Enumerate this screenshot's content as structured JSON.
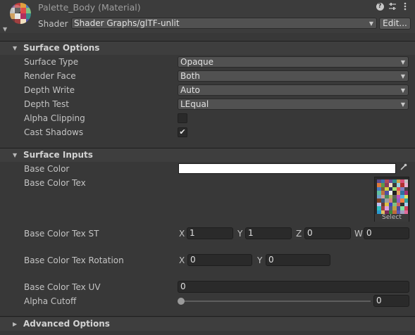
{
  "header": {
    "title": "Palette_Body (Material)",
    "shader_label": "Shader",
    "shader_value": "Shader Graphs/glTF-unlit",
    "edit_label": "Edit...",
    "icons": [
      "help-icon",
      "settings-sliders-icon",
      "more-icon"
    ]
  },
  "surface_options": {
    "title": "Surface Options",
    "rows": [
      {
        "label": "Surface Type",
        "value": "Opaque"
      },
      {
        "label": "Render Face",
        "value": "Both"
      },
      {
        "label": "Depth Write",
        "value": "Auto"
      },
      {
        "label": "Depth Test",
        "value": "LEqual"
      }
    ],
    "alpha_clipping": {
      "label": "Alpha Clipping",
      "checked": false
    },
    "cast_shadows": {
      "label": "Cast Shadows",
      "checked": true
    }
  },
  "surface_inputs": {
    "title": "Surface Inputs",
    "base_color": {
      "label": "Base Color",
      "color": "#ffffff"
    },
    "base_color_tex": {
      "label": "Base Color Tex",
      "select_label": "Select"
    },
    "tex_st": {
      "label": "Base Color Tex ST",
      "x": "1",
      "y": "1",
      "z": "0",
      "w": "0"
    },
    "tex_rotation": {
      "label": "Base Color Tex Rotation",
      "x": "0",
      "y": "0"
    },
    "tex_uv": {
      "label": "Base Color Tex UV",
      "value": "0"
    },
    "alpha_cutoff": {
      "label": "Alpha Cutoff",
      "value": "0",
      "fraction": 0.0
    }
  },
  "advanced_options": {
    "title": "Advanced Options"
  },
  "axes": {
    "x": "X",
    "y": "Y",
    "z": "Z",
    "w": "W"
  },
  "palette_colors": [
    "#5a4a8c",
    "#3b6fb0",
    "#b04a5a",
    "#6a4a9a",
    "#2f8f8f",
    "#c9a24b",
    "#d94f7a",
    "#c0c0c0",
    "#e07a3a",
    "#5a9a4a",
    "#8a3a5a",
    "#f0e0c0",
    "#3a3a3a",
    "#9ad0e0",
    "#b03030",
    "#e8b0d0",
    "#4a7ac0",
    "#7a5a3a",
    "#d0d040",
    "#303060",
    "#a0e070",
    "#e05050",
    "#8080c0",
    "#404040",
    "#60c0a0",
    "#c07040",
    "#5050a0",
    "#f0f0f0",
    "#202020",
    "#e0a060",
    "#3070a0",
    "#a03070",
    "#70a0d0",
    "#d0a0a0",
    "#4a8a5a",
    "#b0b060",
    "#606060",
    "#c050c0",
    "#50b0e0",
    "#e0e060",
    "#804020",
    "#3a5a7a",
    "#a0a0a0",
    "#d08080",
    "#407040",
    "#9060c0",
    "#f08040",
    "#30a0a0",
    "#c0c0f0",
    "#6a3a3a",
    "#e0c040",
    "#4040c0",
    "#80c080",
    "#d06060",
    "#303030",
    "#b0d0f0",
    "#30c0c0",
    "#a04040",
    "#e0a0e0",
    "#506080",
    "#c0a040",
    "#4a4a9a",
    "#80e0a0",
    "#d04060",
    "#2a9ad0",
    "#e0c060",
    "#7a2a5a",
    "#3a8a3a",
    "#c06a3a",
    "#5a5ab0",
    "#a0a0c0",
    "#e06a9a"
  ]
}
